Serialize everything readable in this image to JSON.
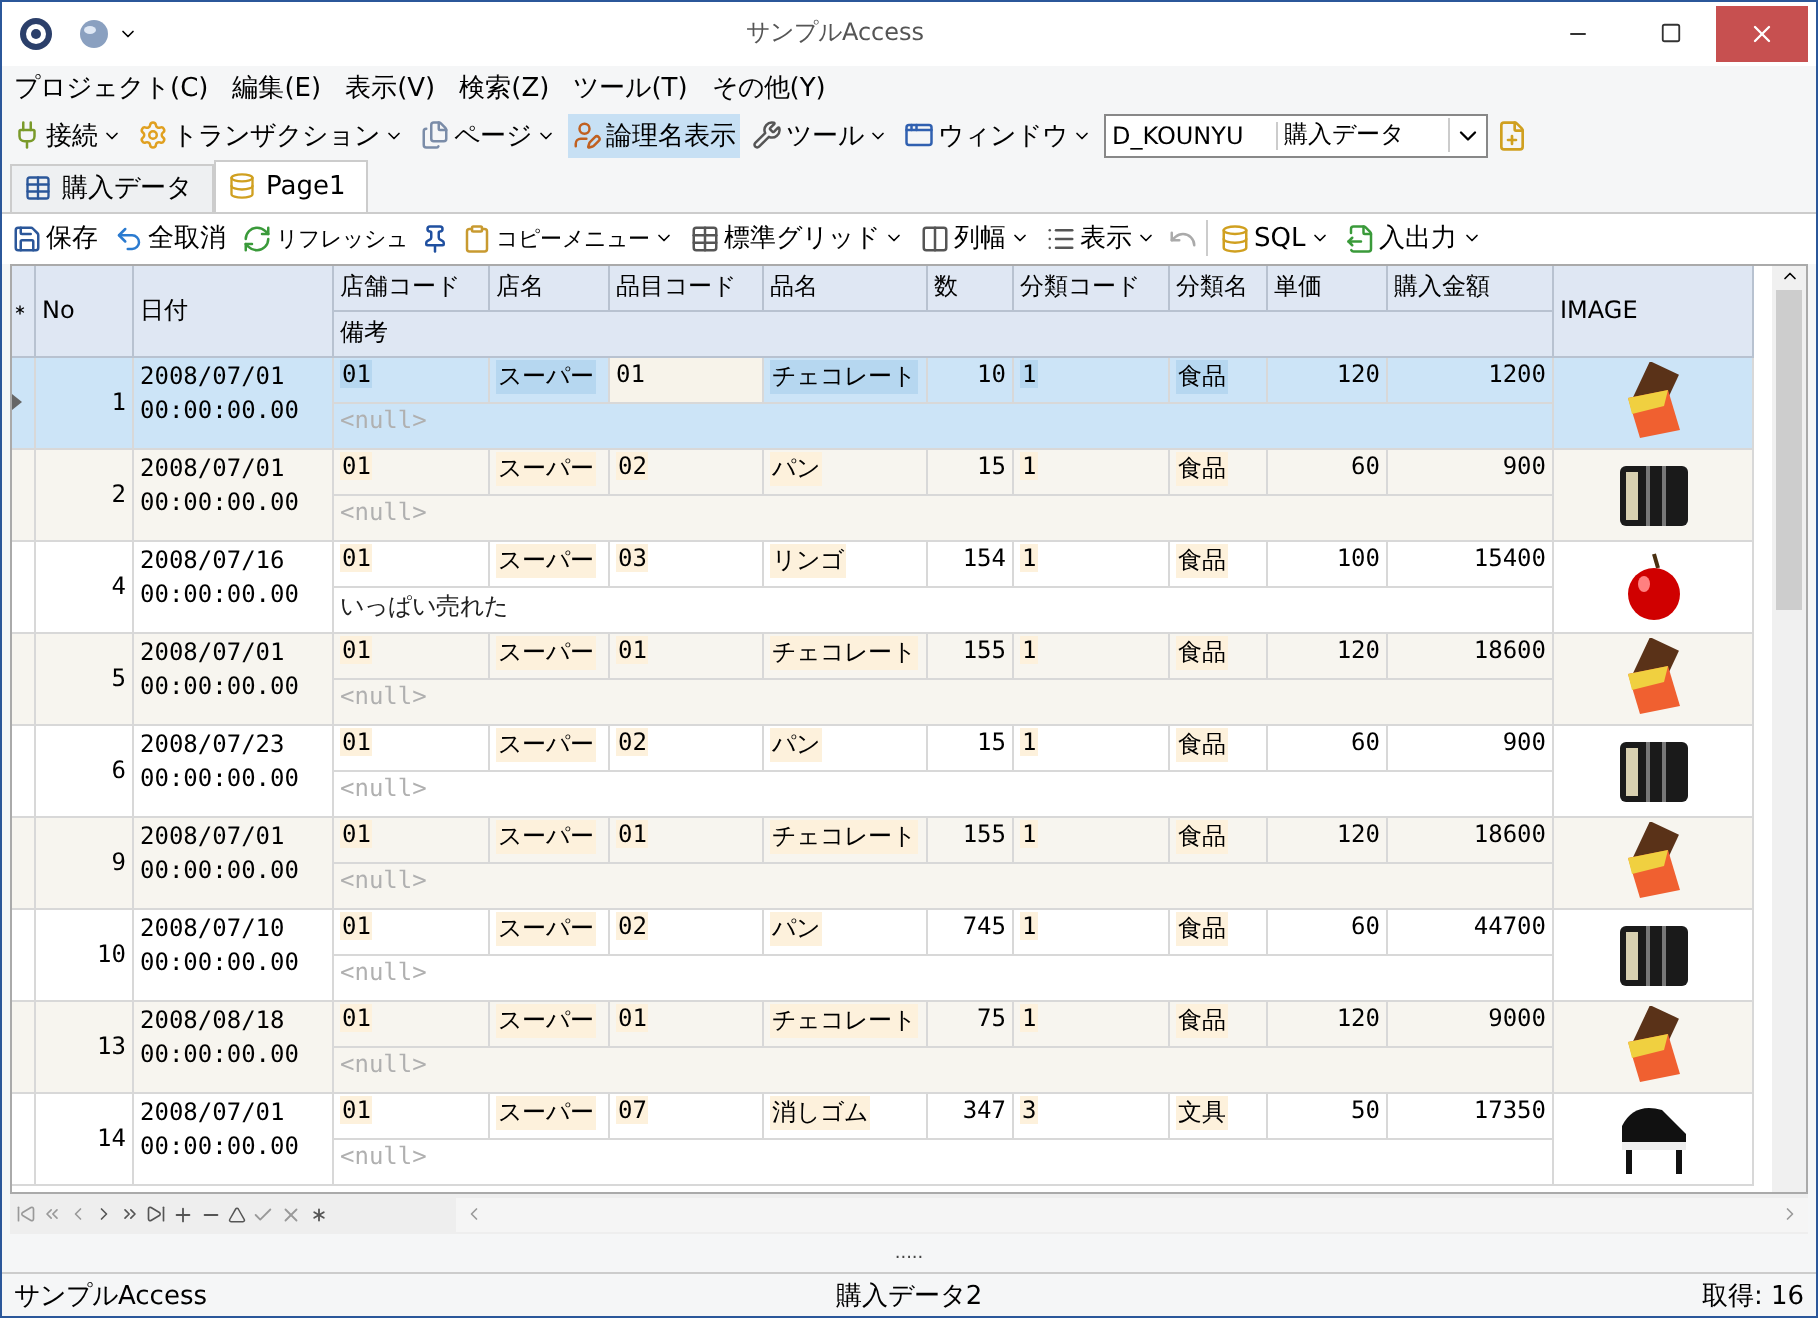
{
  "window": {
    "title": "サンプルAccess"
  },
  "menu": [
    "プロジェクト(C)",
    "編集(E)",
    "表示(V)",
    "検索(Z)",
    "ツール(T)",
    "その他(Y)"
  ],
  "toolbar": [
    {
      "label": "接続",
      "dropdown": true,
      "selected": false
    },
    {
      "label": "トランザクション",
      "dropdown": true,
      "selected": false
    },
    {
      "label": "ページ",
      "dropdown": true,
      "selected": false
    },
    {
      "label": "論理名表示",
      "dropdown": false,
      "selected": true
    },
    {
      "label": "ツール",
      "dropdown": true,
      "selected": false
    },
    {
      "label": "ウィンドウ",
      "dropdown": true,
      "selected": false
    }
  ],
  "connection": {
    "schema": "D_KOUNYU",
    "table": "購入データ"
  },
  "tabs": [
    {
      "label": "購入データ",
      "selected": false
    },
    {
      "label": "Page1",
      "selected": true
    }
  ],
  "grid_toolbar": [
    {
      "kind": "button",
      "label": "保存",
      "dropdown": false
    },
    {
      "kind": "button",
      "label": "全取消",
      "dropdown": false
    },
    {
      "kind": "button",
      "label": "リフレッシュ",
      "dropdown": false
    },
    {
      "kind": "icon"
    },
    {
      "kind": "button",
      "label": "コピーメニュー",
      "dropdown": true
    },
    {
      "kind": "button",
      "label": "標準グリッド",
      "dropdown": true
    },
    {
      "kind": "button",
      "label": "列幅",
      "dropdown": true
    },
    {
      "kind": "button",
      "label": "表示",
      "dropdown": true
    },
    {
      "kind": "icon"
    },
    {
      "kind": "button",
      "label": "SQL",
      "dropdown": true
    },
    {
      "kind": "button",
      "label": "入出力",
      "dropdown": true
    }
  ],
  "table": {
    "columns": [
      "No",
      "日付",
      "店舗コード",
      "店名",
      "品目コード",
      "品名",
      "数",
      "分類コード",
      "分類名",
      "単価",
      "購入金額",
      "IMAGE"
    ],
    "remark_column": "備考",
    "rows": [
      {
        "no": "1",
        "date": "2008/07/01",
        "time": "00:00:00.00",
        "store_code": "01",
        "store": "スーパー",
        "item_code": "01",
        "item": "チェコレート",
        "qty": "10",
        "cat_code": "1",
        "cat": "食品",
        "price": "120",
        "amount": "1200",
        "remark": "<null>",
        "remark_null": true,
        "selected": true
      },
      {
        "no": "2",
        "date": "2008/07/01",
        "time": "00:00:00.00",
        "store_code": "01",
        "store": "スーパー",
        "item_code": "02",
        "item": "パン",
        "qty": "15",
        "cat_code": "1",
        "cat": "食品",
        "price": "60",
        "amount": "900",
        "remark": "<null>",
        "remark_null": true,
        "selected": false
      },
      {
        "no": "4",
        "date": "2008/07/16",
        "time": "00:00:00.00",
        "store_code": "01",
        "store": "スーパー",
        "item_code": "03",
        "item": "リンゴ",
        "qty": "154",
        "cat_code": "1",
        "cat": "食品",
        "price": "100",
        "amount": "15400",
        "remark": "いっぱい売れた",
        "remark_null": false,
        "selected": false
      },
      {
        "no": "5",
        "date": "2008/07/01",
        "time": "00:00:00.00",
        "store_code": "01",
        "store": "スーパー",
        "item_code": "01",
        "item": "チェコレート",
        "qty": "155",
        "cat_code": "1",
        "cat": "食品",
        "price": "120",
        "amount": "18600",
        "remark": "<null>",
        "remark_null": true,
        "selected": false
      },
      {
        "no": "6",
        "date": "2008/07/23",
        "time": "00:00:00.00",
        "store_code": "01",
        "store": "スーパー",
        "item_code": "02",
        "item": "パン",
        "qty": "15",
        "cat_code": "1",
        "cat": "食品",
        "price": "60",
        "amount": "900",
        "remark": "<null>",
        "remark_null": true,
        "selected": false
      },
      {
        "no": "9",
        "date": "2008/07/01",
        "time": "00:00:00.00",
        "store_code": "01",
        "store": "スーパー",
        "item_code": "01",
        "item": "チェコレート",
        "qty": "155",
        "cat_code": "1",
        "cat": "食品",
        "price": "120",
        "amount": "18600",
        "remark": "<null>",
        "remark_null": true,
        "selected": false
      },
      {
        "no": "10",
        "date": "2008/07/10",
        "time": "00:00:00.00",
        "store_code": "01",
        "store": "スーパー",
        "item_code": "02",
        "item": "パン",
        "qty": "745",
        "cat_code": "1",
        "cat": "食品",
        "price": "60",
        "amount": "44700",
        "remark": "<null>",
        "remark_null": true,
        "selected": false
      },
      {
        "no": "13",
        "date": "2008/08/18",
        "time": "00:00:00.00",
        "store_code": "01",
        "store": "スーパー",
        "item_code": "01",
        "item": "チェコレート",
        "qty": "75",
        "cat_code": "1",
        "cat": "食品",
        "price": "120",
        "amount": "9000",
        "remark": "<null>",
        "remark_null": true,
        "selected": false
      },
      {
        "no": "14",
        "date": "2008/07/01",
        "time": "00:00:00.00",
        "store_code": "01",
        "store": "スーパー",
        "item_code": "07",
        "item": "消しゴム",
        "qty": "347",
        "cat_code": "3",
        "cat": "文具",
        "price": "50",
        "amount": "17350",
        "remark": "<null>",
        "remark_null": true,
        "selected": false
      }
    ]
  },
  "splitter": ".....",
  "status_bar": [
    "サンプルAccess",
    "購入データ2",
    "取得: 16"
  ]
}
